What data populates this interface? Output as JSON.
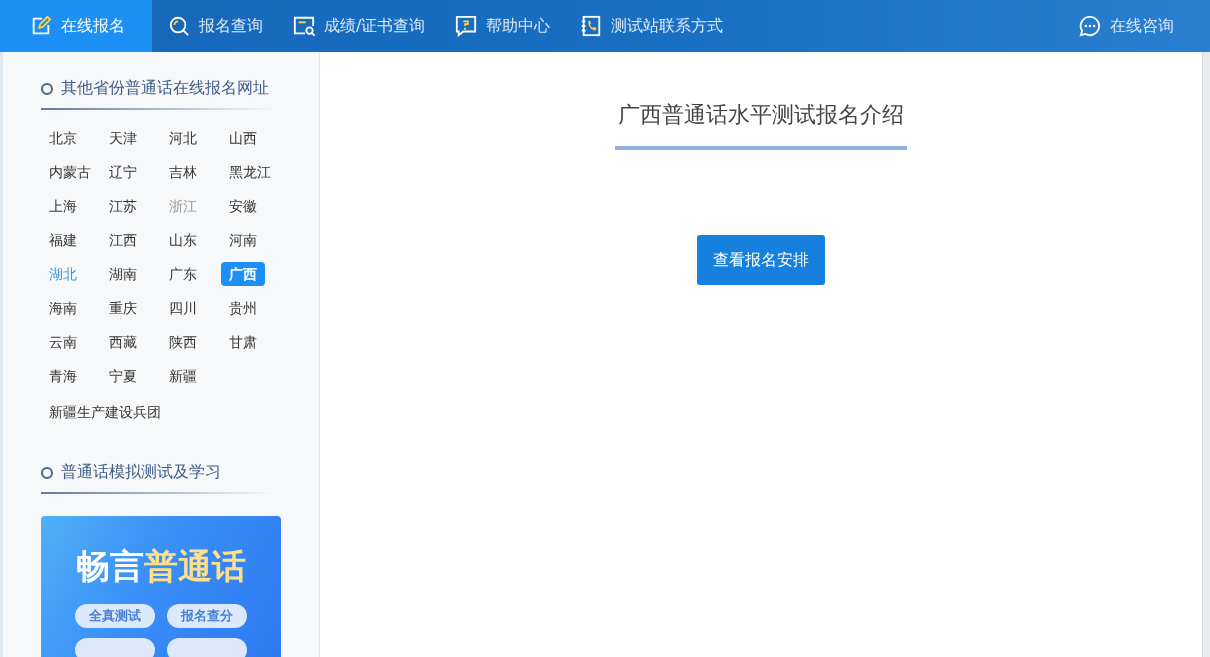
{
  "nav": {
    "items": [
      {
        "label": "在线报名",
        "kind": "edit",
        "selected": true
      },
      {
        "label": "报名查询",
        "kind": "search",
        "selected": false
      },
      {
        "label": "成绩/证书查询",
        "kind": "certificate",
        "selected": false
      },
      {
        "label": "帮助中心",
        "kind": "help",
        "selected": false
      },
      {
        "label": "测试站联系方式",
        "kind": "phone",
        "selected": false
      }
    ],
    "consult": {
      "label": "在线咨询"
    }
  },
  "sidebar": {
    "provinces_title": "其他省份普通话在线报名网址",
    "provinces": [
      {
        "label": "北京",
        "selected": false,
        "disabled": false,
        "highlighted": false
      },
      {
        "label": "天津",
        "selected": false,
        "disabled": false,
        "highlighted": false
      },
      {
        "label": "河北",
        "selected": false,
        "disabled": false,
        "highlighted": false
      },
      {
        "label": "山西",
        "selected": false,
        "disabled": false,
        "highlighted": false
      },
      {
        "label": "内蒙古",
        "selected": false,
        "disabled": false,
        "highlighted": false
      },
      {
        "label": "辽宁",
        "selected": false,
        "disabled": false,
        "highlighted": false
      },
      {
        "label": "吉林",
        "selected": false,
        "disabled": false,
        "highlighted": false
      },
      {
        "label": "黑龙江",
        "selected": false,
        "disabled": false,
        "highlighted": false
      },
      {
        "label": "上海",
        "selected": false,
        "disabled": false,
        "highlighted": false
      },
      {
        "label": "江苏",
        "selected": false,
        "disabled": false,
        "highlighted": false
      },
      {
        "label": "浙江",
        "selected": false,
        "disabled": true,
        "highlighted": false
      },
      {
        "label": "安徽",
        "selected": false,
        "disabled": false,
        "highlighted": false
      },
      {
        "label": "福建",
        "selected": false,
        "disabled": false,
        "highlighted": false
      },
      {
        "label": "江西",
        "selected": false,
        "disabled": false,
        "highlighted": false
      },
      {
        "label": "山东",
        "selected": false,
        "disabled": false,
        "highlighted": false
      },
      {
        "label": "河南",
        "selected": false,
        "disabled": false,
        "highlighted": false
      },
      {
        "label": "湖北",
        "selected": false,
        "disabled": false,
        "highlighted": true
      },
      {
        "label": "湖南",
        "selected": false,
        "disabled": false,
        "highlighted": false
      },
      {
        "label": "广东",
        "selected": false,
        "disabled": false,
        "highlighted": false
      },
      {
        "label": "广西",
        "selected": true,
        "disabled": false,
        "highlighted": false
      },
      {
        "label": "海南",
        "selected": false,
        "disabled": false,
        "highlighted": false
      },
      {
        "label": "重庆",
        "selected": false,
        "disabled": false,
        "highlighted": false
      },
      {
        "label": "四川",
        "selected": false,
        "disabled": false,
        "highlighted": false
      },
      {
        "label": "贵州",
        "selected": false,
        "disabled": false,
        "highlighted": false
      },
      {
        "label": "云南",
        "selected": false,
        "disabled": false,
        "highlighted": false
      },
      {
        "label": "西藏",
        "selected": false,
        "disabled": false,
        "highlighted": false
      },
      {
        "label": "陕西",
        "selected": false,
        "disabled": false,
        "highlighted": false
      },
      {
        "label": "甘肃",
        "selected": false,
        "disabled": false,
        "highlighted": false
      },
      {
        "label": "青海",
        "selected": false,
        "disabled": false,
        "highlighted": false
      },
      {
        "label": "宁夏",
        "selected": false,
        "disabled": false,
        "highlighted": false
      },
      {
        "label": "新疆",
        "selected": false,
        "disabled": false,
        "highlighted": false
      }
    ],
    "extra_link": "新疆生产建设兵团",
    "study_title": "普通话模拟测试及学习",
    "banner": {
      "title_white": "畅言",
      "title_yellow": "普通话",
      "tags": [
        "全真测试",
        "报名查分"
      ]
    }
  },
  "main": {
    "title": "广西普通话水平测试报名介绍",
    "button": "查看报名安排"
  }
}
